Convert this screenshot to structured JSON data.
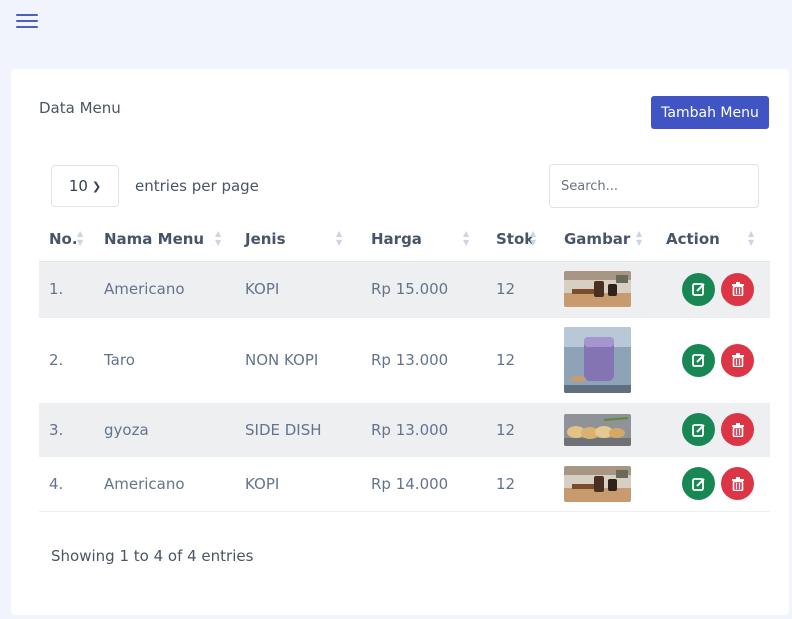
{
  "card_title": "Data Menu",
  "add_button_label": "Tambah Menu",
  "entries": {
    "value": "10",
    "label": "entries per page"
  },
  "search": {
    "placeholder": "Search..."
  },
  "columns": [
    "No.",
    "Nama Menu",
    "Jenis",
    "Harga",
    "Stok",
    "Gambar",
    "Action"
  ],
  "rows": [
    {
      "no": "1.",
      "name": "Americano",
      "type": "KOPI",
      "price": "Rp 15.000",
      "stock": "12",
      "image": "americano-photo"
    },
    {
      "no": "2.",
      "name": "Taro",
      "type": "NON KOPI",
      "price": "Rp 13.000",
      "stock": "12",
      "image": "taro-photo"
    },
    {
      "no": "3.",
      "name": "gyoza",
      "type": "SIDE DISH",
      "price": "Rp 13.000",
      "stock": "12",
      "image": "gyoza-photo"
    },
    {
      "no": "4.",
      "name": "Americano",
      "type": "KOPI",
      "price": "Rp 14.000",
      "stock": "12",
      "image": "americano-photo"
    }
  ],
  "footer_info": "Showing 1 to 4 of 4 entries",
  "icons": {
    "menu": "hamburger-menu-icon",
    "edit": "edit-icon",
    "delete": "trash-icon",
    "dropdown": "chevron-down-icon",
    "sort": "sort-icon"
  },
  "colors": {
    "primary": "#4154c3",
    "edit": "#198754",
    "delete": "#dc3545",
    "row_stripe": "#eeeff1",
    "topbar": "#f1f4fd"
  }
}
